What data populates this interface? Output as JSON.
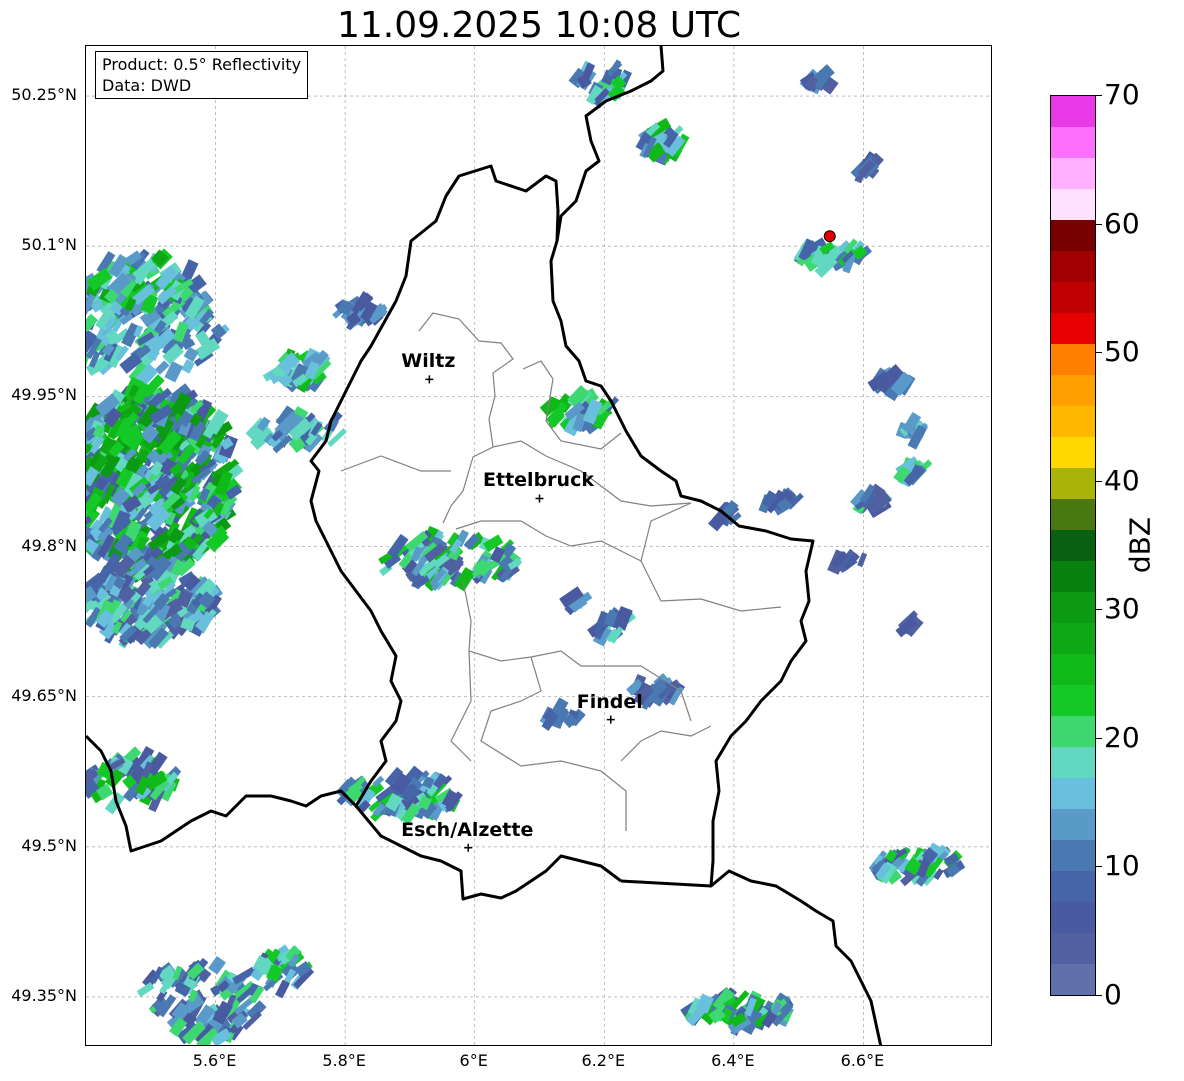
{
  "title": "11.09.2025 10:08 UTC",
  "info": {
    "product": "Product: 0.5° Reflectivity",
    "source": "Data: DWD"
  },
  "extent": {
    "lon": [
      5.4,
      6.8
    ],
    "lat": [
      49.3,
      50.3
    ]
  },
  "lat_ticks": [
    "50.25°N",
    "50.1°N",
    "49.95°N",
    "49.8°N",
    "49.65°N",
    "49.5°N",
    "49.35°N"
  ],
  "lat_values": [
    50.25,
    50.1,
    49.95,
    49.8,
    49.65,
    49.5,
    49.35
  ],
  "lon_ticks": [
    "5.6°E",
    "5.8°E",
    "6°E",
    "6.2°E",
    "6.4°E",
    "6.6°E"
  ],
  "lon_values": [
    5.6,
    5.8,
    6.0,
    6.2,
    6.4,
    6.6
  ],
  "cities": [
    {
      "name": "Wiltz",
      "lon": 5.93,
      "lat": 49.967
    },
    {
      "name": "Ettelbruck",
      "lon": 6.1,
      "lat": 49.848
    },
    {
      "name": "Findel",
      "lon": 6.21,
      "lat": 49.627
    },
    {
      "name": "Esch/Alzette",
      "lon": 5.99,
      "lat": 49.499
    }
  ],
  "radar_site": {
    "lon": 6.548,
    "lat": 50.11,
    "color": "#e00000"
  },
  "colorbar": {
    "label": "dBZ",
    "ticks": [
      "0",
      "10",
      "20",
      "30",
      "40",
      "50",
      "60",
      "70"
    ],
    "colors": [
      "#6070a8",
      "#5060a0",
      "#4a5aa0",
      "#4565a8",
      "#4a78b0",
      "#5a9ac8",
      "#68c0dc",
      "#62d8c0",
      "#3ed870",
      "#14c828",
      "#10b818",
      "#0ea814",
      "#0c9a12",
      "#0a8010",
      "#086010",
      "#4a7810",
      "#aab408",
      "#ffd800",
      "#ffb800",
      "#ffa000",
      "#ff8000",
      "#e80000",
      "#c00000",
      "#a00000",
      "#780000",
      "#ffe0ff",
      "#ffb0ff",
      "#ff70ff",
      "#e838e8"
    ]
  }
}
